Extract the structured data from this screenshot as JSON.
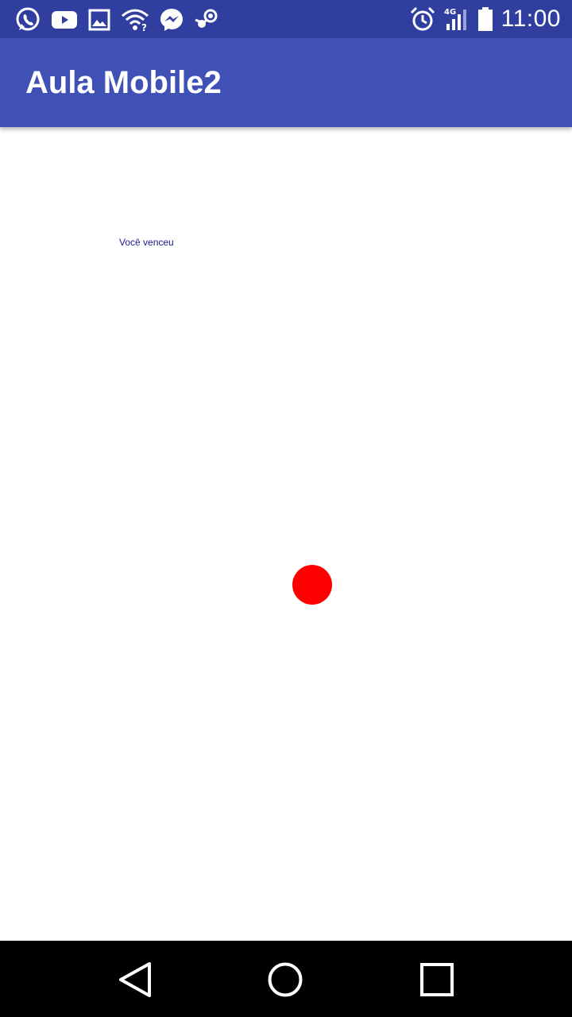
{
  "status_bar": {
    "time": "11:00",
    "network_label": "4G",
    "background_color": "#303F9F",
    "left_icons": [
      "whatsapp-icon",
      "youtube-icon",
      "gallery-icon",
      "wifi-question-icon",
      "messenger-icon",
      "steam-icon"
    ],
    "right_icons": [
      "alarm-icon",
      "signal-4g-icon",
      "battery-icon"
    ]
  },
  "app_bar": {
    "title": "Aula Mobile2",
    "background_color": "#3F51B5"
  },
  "main": {
    "result_text": "Você venceu",
    "result_text_color": "#1a1a8c",
    "ball_color": "#FF0000"
  },
  "nav_bar": {
    "buttons": [
      "back-icon",
      "home-icon",
      "recents-icon"
    ],
    "background_color": "#000000"
  }
}
